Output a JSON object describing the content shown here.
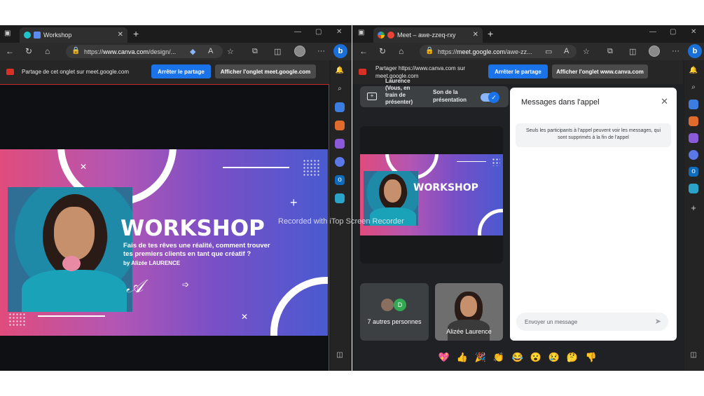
{
  "watermark": "Recorded with iTop Screen Recorder",
  "left": {
    "tab_title": "Workshop",
    "url_prefix": "https://",
    "url_domain": "www.canva.com",
    "url_path": "/design/...",
    "share_text": "Partage de cet onglet sur meet.google.com",
    "stop_button": "Arrêter le partage",
    "show_tab_button": "Afficher l'onglet meet.google.com"
  },
  "right": {
    "tab_title": "Meet – awe-zzeq-rxy",
    "url_prefix": "https://",
    "url_domain": "meet.google.com",
    "url_path": "/awe-zz...",
    "share_text_1": "Partager https://www.canva.com sur",
    "share_text_2": "meet.google.com",
    "stop_button": "Arrêter le partage",
    "show_tab_button": "Afficher l'onglet www.canva.com"
  },
  "slide": {
    "title": "WORKSHOP",
    "subtitle_1": "Fais de tes rêves une réalité, comment trouver",
    "subtitle_2": "tes premiers clients en tant que créatif ?",
    "author": "by Alizée LAURENCE"
  },
  "meet": {
    "presenter_1": "Laurence",
    "presenter_2": "(Vous, en",
    "presenter_3": "train de",
    "presenter_4": "présenter)",
    "audio_1": "Son de la",
    "audio_2": "présentation",
    "others_initial": "D",
    "others_label": "7 autres personnes",
    "participant_name": "Alizée Laurence",
    "chat_title": "Messages dans l'appel",
    "chat_notice": "Seuls les participants à l'appel peuvent voir les messages, qui sont supprimés à la fin de l'appel",
    "chat_placeholder": "Envoyer un message",
    "reactions": [
      "💖",
      "👍",
      "🎉",
      "👏",
      "😂",
      "😮",
      "😢",
      "🤔",
      "👎"
    ]
  },
  "colors": {
    "accent_blue": "#1a73e8",
    "share_red": "#d93025",
    "slide_pink": "#e04c7c",
    "slide_blue": "#4a5ad0"
  }
}
